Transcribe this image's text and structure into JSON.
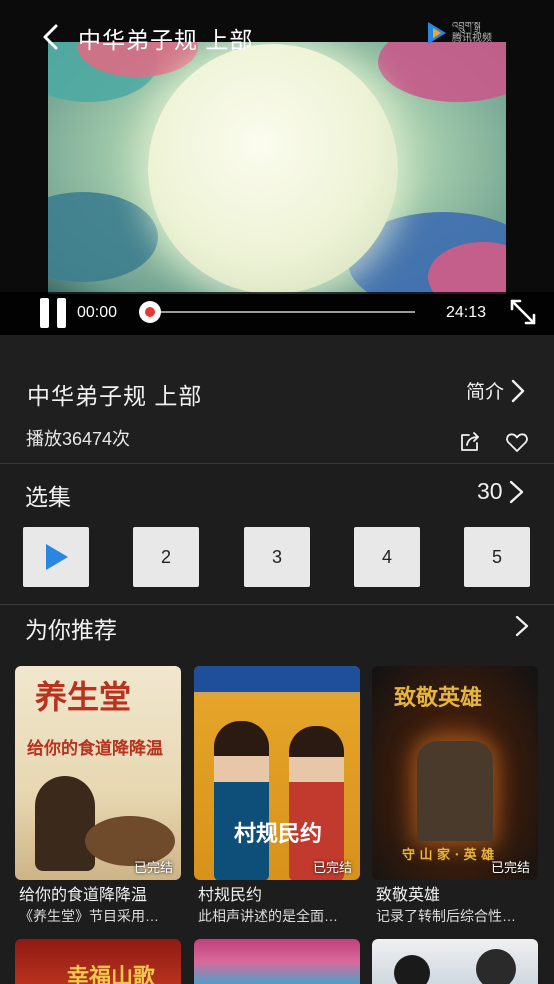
{
  "player": {
    "title": "中华弟子规 上部",
    "watermark_line1": "འབྲུག་སྒྲ",
    "watermark_line2": "腾讯视频",
    "current_time": "00:00",
    "total_time": "24:13",
    "progress_fraction": 0.0,
    "accent_color": "#e53935"
  },
  "info": {
    "title": "中华弟子规 上部",
    "intro_label": "简介",
    "play_count": "播放36474次"
  },
  "episodes": {
    "heading": "选集",
    "count": "30",
    "items": [
      "2",
      "3",
      "4",
      "5"
    ],
    "play_icon_color": "#2a86e0"
  },
  "recommend": {
    "heading": "为你推荐",
    "cards": [
      {
        "title": "给你的食道降降温",
        "desc": "《养生堂》节目采用…",
        "badge": "已完结",
        "poster_heading": "养生堂",
        "poster_sub": "给你的食道降降温"
      },
      {
        "title": "村规民约",
        "desc": "此相声讲述的是全面…",
        "badge": "已完结",
        "poster_heading": "村规民约"
      },
      {
        "title": "致敬英雄",
        "desc": "记录了转制后综合性…",
        "badge": "已完结",
        "poster_heading": "致敬英雄",
        "poster_sub": "守 山 家 · 英 雄"
      }
    ],
    "row2_headings": [
      "幸福山歌",
      "",
      ""
    ]
  }
}
